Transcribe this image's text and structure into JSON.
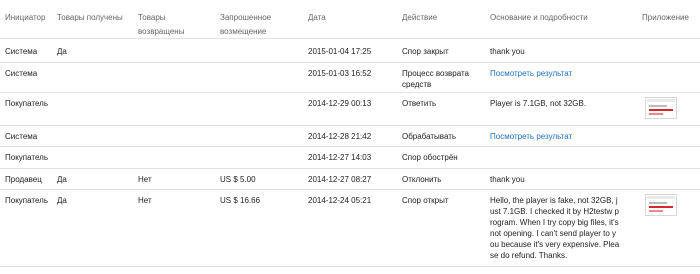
{
  "headers": {
    "initiator": "Инициатор",
    "goods_received": "Товары получены",
    "goods_returned": [
      "Товары",
      "возвращены"
    ],
    "requested_refund": [
      "Запрошенное",
      "возмещение"
    ],
    "date": "Дата",
    "action": "Действие",
    "reason": "Основание и подробности",
    "attachment": "Приложение"
  },
  "rows": [
    {
      "initiator": "Система",
      "received": "Да",
      "returned": "",
      "refund": "",
      "date": "2015-01-04 17:25",
      "action": "Спор закрыт",
      "reason": "thank you",
      "reason_is_link": false,
      "attachment": false
    },
    {
      "initiator": "Система",
      "received": "",
      "returned": "",
      "refund": "",
      "date": "2015-01-03 16:52",
      "action": "Процесс возврата средств",
      "reason": "Посмотреть результат",
      "reason_is_link": true,
      "attachment": false
    },
    {
      "initiator": "Покупатель",
      "received": "",
      "returned": "",
      "refund": "",
      "date": "2014-12-29 00:13",
      "action": "Ответить",
      "reason": "Player is 7.1GB, not 32GB.",
      "reason_is_link": false,
      "attachment": true
    },
    {
      "initiator": "Система",
      "received": "",
      "returned": "",
      "refund": "",
      "date": "2014-12-28 21:42",
      "action": "Обрабатывать",
      "reason": "Посмотреть результат",
      "reason_is_link": true,
      "attachment": false
    },
    {
      "initiator": "Покупатель",
      "received": "",
      "returned": "",
      "refund": "",
      "date": "2014-12-27 14:03",
      "action": "Спор обострён",
      "reason": "",
      "reason_is_link": false,
      "attachment": false
    },
    {
      "initiator": "Продавец",
      "received": "Да",
      "returned": "Нет",
      "refund": "US $ 5.00",
      "date": "2014-12-27 08:27",
      "action": "Отклонить",
      "reason": "thank you",
      "reason_is_link": false,
      "attachment": false
    },
    {
      "initiator": "Покупатель",
      "received": "Да",
      "returned": "Нет",
      "refund": "US $ 16.66",
      "date": "2014-12-24 05:21",
      "action": "Спор открыт",
      "reason": "Hello, the player is fake, not 32GB, just 7.1GB. I checked it by H2testw program. When I try copy big files, it's not opening. I can't send player to you because it's very expensive. Please do refund. Thanks.",
      "reason_is_link": false,
      "attachment": true
    }
  ],
  "reason_wrapped_lines": [
    "Hello, the player is fake, not 32GB, j",
    "ust 7.1GB. I checked it by H2testw p",
    "rogram. When I try copy big files, it's",
    "not opening. I can't send player to y",
    "ou because it's very expensive. Plea",
    "se do refund. Thanks."
  ],
  "colors": {
    "link": "#1a6fc2",
    "divider": "#e2e2e2",
    "header_text": "#666666",
    "thumb_accent": "#d7262d"
  }
}
